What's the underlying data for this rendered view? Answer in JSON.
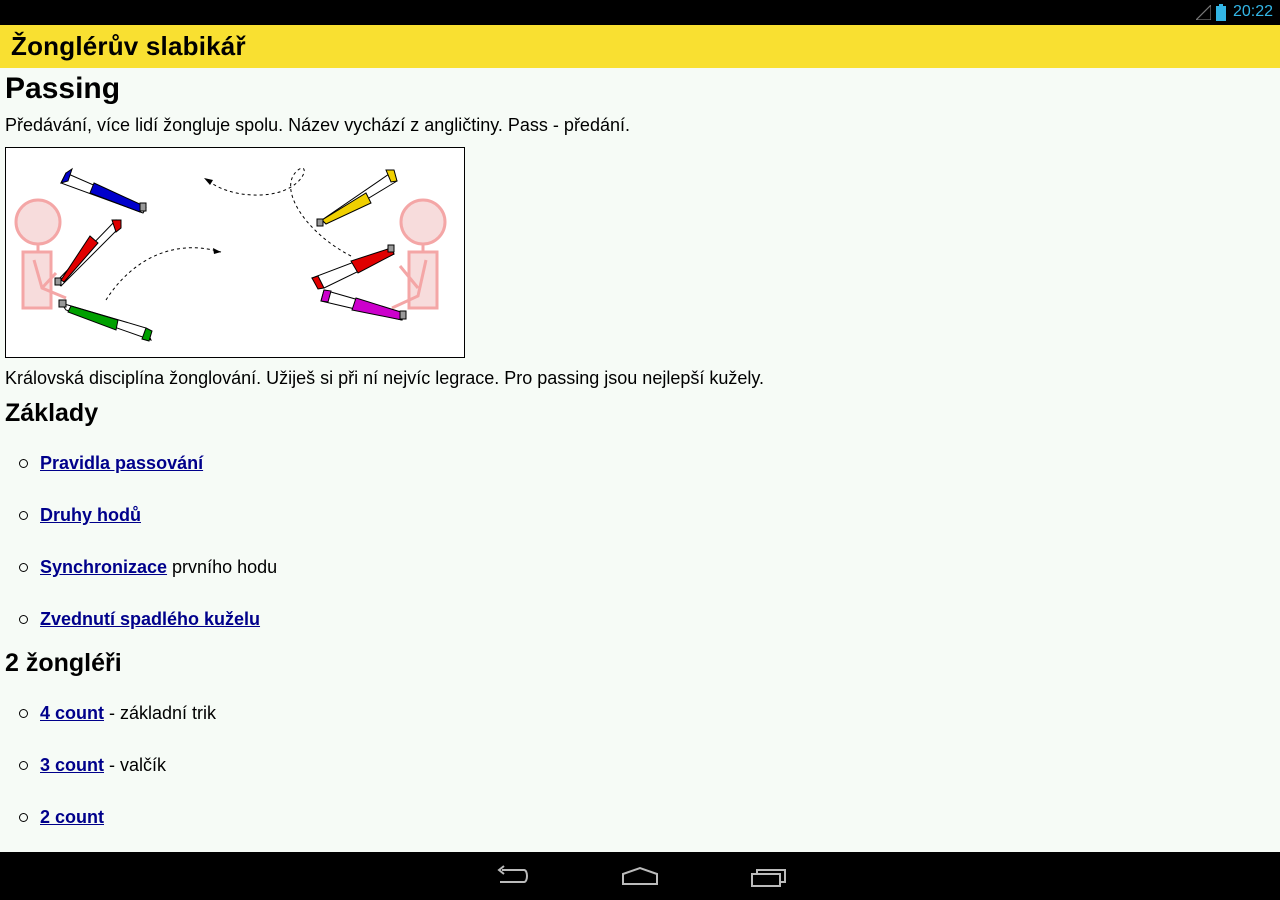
{
  "status": {
    "time": "20:22"
  },
  "app": {
    "title": "Žonglérův slabikář"
  },
  "page": {
    "title": "Passing",
    "intro": "Předávání, více lidí žongluje spolu. Název vychází z angličtiny. Pass - předání.",
    "description": "Královská disciplína žonglování. Užiješ si při ní nejvíc legrace. Pro passing jsou nejlepší kužely."
  },
  "sections": [
    {
      "heading": "Základy",
      "items": [
        {
          "link": "Pravidla passování",
          "suffix": ""
        },
        {
          "link": "Druhy hodů",
          "suffix": ""
        },
        {
          "link": "Synchronizace",
          "suffix": " prvního hodu"
        },
        {
          "link": "Zvednutí spadlého kuželu",
          "suffix": ""
        }
      ]
    },
    {
      "heading": "2 žongléři",
      "items": [
        {
          "link": "4 count",
          "suffix": " - základní trik"
        },
        {
          "link": "3 count",
          "suffix": " - valčík"
        },
        {
          "link": "2 count",
          "suffix": ""
        }
      ]
    }
  ],
  "icons": {
    "signal": "signal-icon",
    "battery": "battery-icon",
    "back": "back-icon",
    "home": "home-icon",
    "recents": "recent-apps-icon"
  },
  "colors": {
    "app_bar": "#f9e031",
    "link": "#00008b",
    "clock": "#33b5e5",
    "juggler": "#f4a6a6"
  }
}
